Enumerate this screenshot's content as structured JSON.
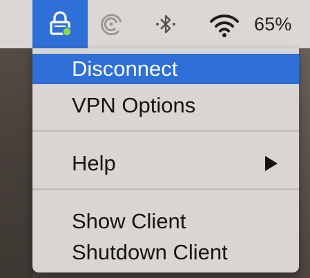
{
  "menubar": {
    "icons": {
      "vpn": "vpn-lock-icon",
      "cloud": "sync-swirl-icon",
      "bluetooth": "bluetooth-icon",
      "wifi": "wifi-icon"
    },
    "battery_percent": "65%",
    "highlight_color": "#2f6fd8",
    "vpn_status_color": "#8fd94a"
  },
  "menu": {
    "items": [
      {
        "label": "Disconnect",
        "highlighted": true
      },
      {
        "label": "VPN Options",
        "highlighted": false
      },
      {
        "label": "Help",
        "has_submenu": true
      },
      {
        "label": "Show Client",
        "highlighted": false
      },
      {
        "label": "Shutdown Client",
        "highlighted": false
      }
    ]
  }
}
